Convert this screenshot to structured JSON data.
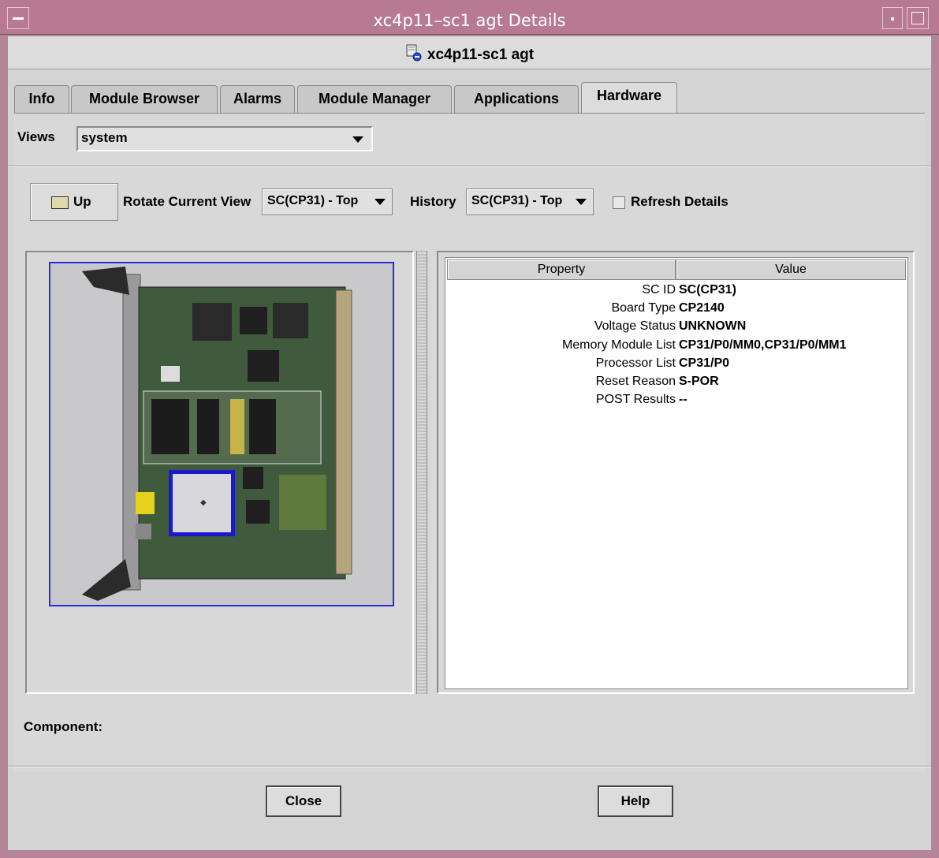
{
  "window": {
    "title": "xc4p11–sc1 agt Details"
  },
  "header": {
    "agent_name": "xc4p11-sc1 agt"
  },
  "tabs": [
    {
      "label": "Info",
      "active": false
    },
    {
      "label": "Module Browser",
      "active": false
    },
    {
      "label": "Alarms",
      "active": false
    },
    {
      "label": "Module Manager",
      "active": false
    },
    {
      "label": "Applications",
      "active": false
    },
    {
      "label": "Hardware",
      "active": true
    }
  ],
  "views": {
    "label": "Views",
    "selected": "system"
  },
  "toolbar": {
    "up_label": "Up",
    "rotate_label": "Rotate Current View",
    "rotate_selected": "SC(CP31) - Top",
    "history_label": "History",
    "history_selected": "SC(CP31) - Top",
    "refresh_label": "Refresh Details",
    "refresh_checked": false
  },
  "properties": {
    "columns": [
      "Property",
      "Value"
    ],
    "rows": [
      {
        "property": "SC ID",
        "value": "SC(CP31)"
      },
      {
        "property": "Board Type",
        "value": "CP2140"
      },
      {
        "property": "Voltage Status",
        "value": "UNKNOWN"
      },
      {
        "property": "Memory Module List",
        "value": "CP31/P0/MM0,CP31/P0/MM1"
      },
      {
        "property": "Processor List",
        "value": "CP31/P0"
      },
      {
        "property": "Reset Reason",
        "value": "S-POR"
      },
      {
        "property": "POST Results",
        "value": "--"
      }
    ]
  },
  "component": {
    "label": "Component:",
    "value": ""
  },
  "footer": {
    "close_label": "Close",
    "help_label": "Help"
  },
  "colors": {
    "titlebar": "#b87a92",
    "selection_border": "#2a2ae0",
    "panel_bg": "#d4d4d4"
  }
}
